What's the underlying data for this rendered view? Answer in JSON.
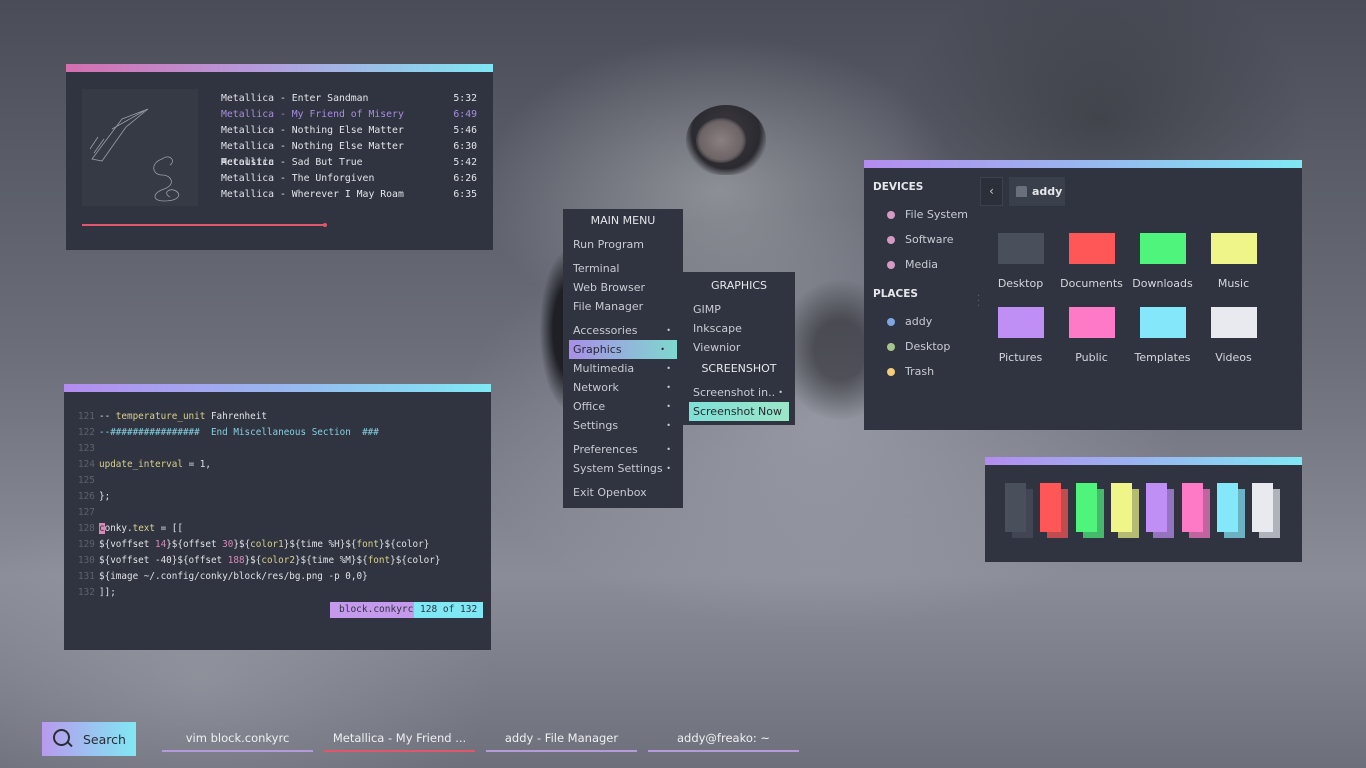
{
  "music": {
    "tracks": [
      {
        "title": "Metallica - Enter Sandman",
        "time": "5:32",
        "active": false
      },
      {
        "title": "Metallica - My Friend of Misery",
        "time": "6:49",
        "active": true
      },
      {
        "title": "Metallica - Nothing Else Matter",
        "time": "5:46",
        "active": false
      },
      {
        "title": "Metallica - Nothing Else Matter Accoustic",
        "time": "6:30",
        "active": false
      },
      {
        "title": "Metallica - Sad But True",
        "time": "5:42",
        "active": false
      },
      {
        "title": "Metallica - The Unforgiven",
        "time": "6:26",
        "active": false
      },
      {
        "title": "Metallica - Wherever I May Roam",
        "time": "6:35",
        "active": false
      }
    ],
    "progress_fraction": 0.57,
    "album_art": "metallica-black-album"
  },
  "editor": {
    "lines": [
      {
        "num": "121",
        "parts": [
          [
            "t",
            "-- "
          ],
          [
            "y",
            "temperature_unit"
          ],
          [
            "t",
            " Fahrenheit"
          ]
        ]
      },
      {
        "num": "122",
        "parts": [
          [
            "c",
            "--################  End Miscellaneous Section  ###"
          ]
        ]
      },
      {
        "num": "123",
        "parts": []
      },
      {
        "num": "124",
        "parts": [
          [
            "y",
            "update_interval"
          ],
          [
            "t",
            " = 1,"
          ]
        ]
      },
      {
        "num": "125",
        "parts": []
      },
      {
        "num": "126",
        "parts": [
          [
            "t",
            "};"
          ]
        ]
      },
      {
        "num": "127",
        "parts": []
      },
      {
        "num": "128",
        "parts": [
          [
            "cur",
            "c"
          ],
          [
            "t",
            "onky."
          ],
          [
            "y",
            "text"
          ],
          [
            "t",
            " = [["
          ]
        ]
      },
      {
        "num": "129",
        "parts": [
          [
            "t",
            "${voffset "
          ],
          [
            "p",
            "14"
          ],
          [
            "t",
            "}${offset "
          ],
          [
            "p",
            "30"
          ],
          [
            "t",
            "}${"
          ],
          [
            "y",
            "color1"
          ],
          [
            "t",
            "}${time %H}${"
          ],
          [
            "y",
            "font"
          ],
          [
            "t",
            "}${color}"
          ]
        ]
      },
      {
        "num": "130",
        "parts": [
          [
            "t",
            "${voffset -40}${offset "
          ],
          [
            "p",
            "188"
          ],
          [
            "t",
            "}${"
          ],
          [
            "y",
            "color2"
          ],
          [
            "t",
            "}${time %M}${"
          ],
          [
            "y",
            "font"
          ],
          [
            "t",
            "}${color}"
          ]
        ]
      },
      {
        "num": "131",
        "parts": [
          [
            "t",
            "${image ~/.config/conky/block/res/bg.png -p 0,0}"
          ]
        ]
      },
      {
        "num": "132",
        "parts": [
          [
            "t",
            "]];"
          ]
        ]
      }
    ],
    "filename": "block.conkyrc",
    "position": "128 of 132"
  },
  "main_menu": {
    "title": "MAIN MENU",
    "groups": [
      [
        {
          "label": "Run Program",
          "sub": false
        }
      ],
      [
        {
          "label": "Terminal",
          "sub": false
        },
        {
          "label": "Web Browser",
          "sub": false
        },
        {
          "label": "File Manager",
          "sub": false
        }
      ],
      [
        {
          "label": "Accessories",
          "sub": true
        },
        {
          "label": "Graphics",
          "sub": true,
          "hl": true
        },
        {
          "label": "Multimedia",
          "sub": true
        },
        {
          "label": "Network",
          "sub": true
        },
        {
          "label": "Office",
          "sub": true
        },
        {
          "label": "Settings",
          "sub": true
        }
      ],
      [
        {
          "label": "Preferences",
          "sub": true
        },
        {
          "label": "System Settings",
          "sub": true
        }
      ],
      [
        {
          "label": "Exit Openbox",
          "sub": false
        }
      ]
    ]
  },
  "graphics_menu": {
    "title": "GRAPHICS",
    "items": [
      "GIMP",
      "Inkscape",
      "Viewnior"
    ],
    "screenshot_title": "SCREENSHOT",
    "screenshot_items": [
      {
        "label": "Screenshot in..",
        "sub": true,
        "hl": false
      },
      {
        "label": "Screenshot Now",
        "sub": false,
        "hl": true
      }
    ]
  },
  "file_manager": {
    "devices_title": "DEVICES",
    "devices": [
      {
        "label": "File System",
        "color": "#d59ac4"
      },
      {
        "label": "Software",
        "color": "#d59ac4"
      },
      {
        "label": "Media",
        "color": "#d59ac4"
      }
    ],
    "places_title": "PLACES",
    "places": [
      {
        "label": "addy",
        "color": "#7ea6e0"
      },
      {
        "label": "Desktop",
        "color": "#a6c58a"
      },
      {
        "label": "Trash",
        "color": "#f2cd7a"
      }
    ],
    "back_label": "‹",
    "path": "addy",
    "folders": [
      {
        "label": "Desktop",
        "color": "#4a4f5c"
      },
      {
        "label": "Documents",
        "color": "#ff5757"
      },
      {
        "label": "Downloads",
        "color": "#4ff47c"
      },
      {
        "label": "Music",
        "color": "#f0f58a"
      },
      {
        "label": "Pictures",
        "color": "#bf8ff5"
      },
      {
        "label": "Public",
        "color": "#ff7ac6"
      },
      {
        "label": "Templates",
        "color": "#85e8fa"
      },
      {
        "label": "Videos",
        "color": "#e8eaef"
      }
    ]
  },
  "palette": {
    "colors": [
      "#4a4f5c",
      "#ff5757",
      "#4ff47c",
      "#f0f58a",
      "#bf8ff5",
      "#ff7ac6",
      "#85e8fa",
      "#e8eaef"
    ]
  },
  "taskbar": {
    "search_label": "Search",
    "tasks": [
      {
        "label": "vim block.conkyrc",
        "color": "#b59adc"
      },
      {
        "label": "Metallica - My Friend ...",
        "color": "#e0566a"
      },
      {
        "label": "addy - File Manager",
        "color": "#b59adc"
      },
      {
        "label": "addy@freako: ~",
        "color": "#b59adc"
      }
    ]
  }
}
